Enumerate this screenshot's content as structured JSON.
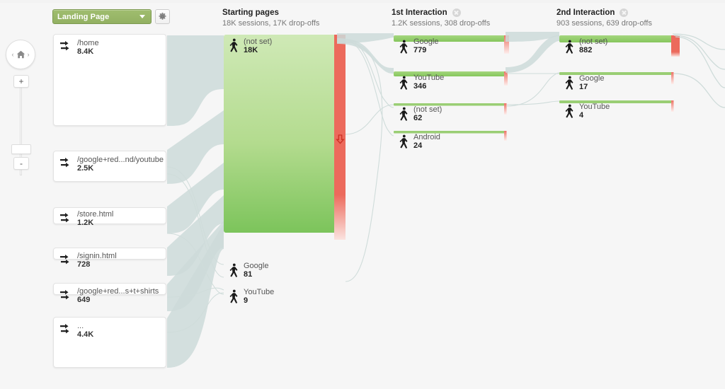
{
  "toolbar": {
    "dimension_label": "Landing Page",
    "settings_icon": "gear-icon",
    "caret_icon": "chevron-down-icon"
  },
  "zoom_control": {
    "home_icon": "home-icon",
    "prev_icon": "chevron-left-icon",
    "next_icon": "chevron-right-icon",
    "zoom_in_label": "+",
    "zoom_out_label": "-"
  },
  "columns": [
    {
      "key": "starting_pages",
      "title": "Starting pages",
      "subtitle": "18K sessions, 17K drop-offs",
      "closable": false
    },
    {
      "key": "interaction_1",
      "title": "1st Interaction",
      "subtitle": "1.2K sessions, 308 drop-offs",
      "closable": true,
      "close_icon": "close-icon"
    },
    {
      "key": "interaction_2",
      "title": "2nd Interaction",
      "subtitle": "903 sessions, 639 drop-offs",
      "closable": true,
      "close_icon": "close-icon"
    }
  ],
  "landing_pages": [
    {
      "name": "/home",
      "value": "8.4K"
    },
    {
      "name": "/google+red...nd/youtube",
      "value": "2.5K"
    },
    {
      "name": "/store.html",
      "value": "1.2K"
    },
    {
      "name": "/signin.html",
      "value": "728"
    },
    {
      "name": "/google+red...s+t+shirts",
      "value": "649"
    },
    {
      "name": "...",
      "value": "4.4K"
    }
  ],
  "starting_pages": [
    {
      "name": "(not set)",
      "value": "18K"
    },
    {
      "name": "Google",
      "value": "81"
    },
    {
      "name": "YouTube",
      "value": "9"
    }
  ],
  "interaction_1": [
    {
      "name": "Google",
      "value": "779"
    },
    {
      "name": "YouTube",
      "value": "346"
    },
    {
      "name": "(not set)",
      "value": "62"
    },
    {
      "name": "Android",
      "value": "24"
    }
  ],
  "interaction_2": [
    {
      "name": "(not set)",
      "value": "882"
    },
    {
      "name": "Google",
      "value": "17"
    },
    {
      "name": "YouTube",
      "value": "4"
    }
  ],
  "icons": {
    "node_traffic_icon": "double-arrow-icon",
    "node_visitor_icon": "walking-person-icon",
    "dropoff_icon": "down-arrow-icon"
  },
  "colors": {
    "accent_green": "#8fbc5a",
    "node_green_light": "#cfe8b4",
    "node_green": "#7cc45b",
    "dropoff_red": "#ec6a5c",
    "flow_gray": "#cfdcda",
    "background": "#f6f6f6"
  }
}
